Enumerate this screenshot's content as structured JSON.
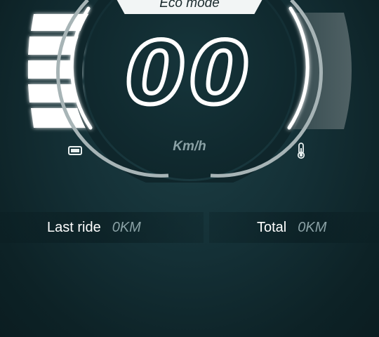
{
  "dashboard": {
    "mode_label": "Eco mode",
    "speed_value": "00",
    "speed_unit": "Km/h",
    "battery_level_bars": 5,
    "battery_icon": "battery-icon",
    "temperature_icon": "thermometer-icon"
  },
  "stats": {
    "last_ride_label": "Last ride",
    "last_ride_value": "0KM",
    "total_label": "Total",
    "total_value": "0KM"
  },
  "colors": {
    "background": "#143036",
    "accent_white": "#ffffff",
    "muted_text": "#8aa1a5"
  }
}
